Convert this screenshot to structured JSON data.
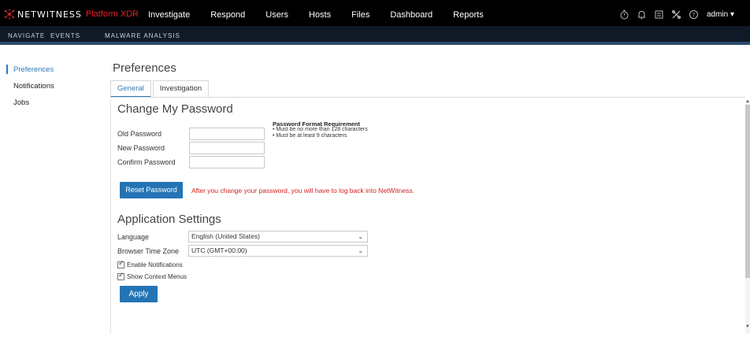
{
  "brand": {
    "name": "NETWITNESS",
    "product": "Platform XDR"
  },
  "main_nav": [
    "Investigate",
    "Respond",
    "Users",
    "Hosts",
    "Files",
    "Dashboard",
    "Reports"
  ],
  "toolbar_icons": [
    "stopwatch-icon",
    "bell-icon",
    "checklist-icon",
    "tools-icon",
    "help-icon"
  ],
  "user": {
    "name": "admin ▾"
  },
  "sub_nav": [
    "NAVIGATE",
    "EVENTS",
    "MALWARE ANALYSIS"
  ],
  "sidebar": {
    "items": [
      {
        "label": "Preferences",
        "active": true
      },
      {
        "label": "Notifications",
        "active": false
      },
      {
        "label": "Jobs",
        "active": false
      }
    ]
  },
  "page": {
    "title": "Preferences",
    "tabs": [
      {
        "label": "General",
        "active": true
      },
      {
        "label": "Investigation",
        "active": false
      }
    ]
  },
  "password": {
    "section_title": "Change My Password",
    "old_label": "Old Password",
    "new_label": "New Password",
    "confirm_label": "Confirm Password",
    "old_value": "",
    "new_value": "",
    "confirm_value": "",
    "requirement_title": "Password Format Requirement",
    "requirement_rules": [
      "• Must be no more than 128 characters",
      "• Must be at least 9 characters"
    ],
    "reset_button": "Reset Password",
    "reset_message": "After you change your password, you will have to log back into NetWitness."
  },
  "app_settings": {
    "section_title": "Application Settings",
    "language_label": "Language",
    "language_value": "English (United States)",
    "timezone_label": "Browser Time Zone",
    "timezone_value": "UTC (GMT+00:00)",
    "enable_notifications": "Enable Notifications",
    "show_context_menus": "Show Context Menus",
    "apply_button": "Apply"
  },
  "colors": {
    "accent": "#2474b5",
    "brand_red": "#e8202a",
    "warning_red": "#d62020",
    "topbar_bg": "#000000",
    "subnav_bg": "#0f1a26"
  }
}
